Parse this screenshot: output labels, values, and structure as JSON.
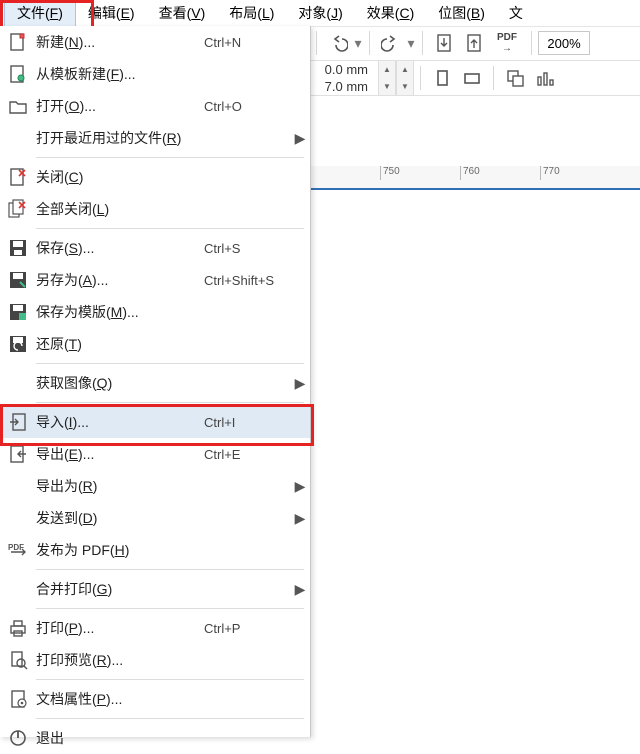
{
  "menubar": [
    {
      "label": "文件",
      "mn": "F",
      "active": true
    },
    {
      "label": "编辑",
      "mn": "E"
    },
    {
      "label": "查看",
      "mn": "V"
    },
    {
      "label": "布局",
      "mn": "L"
    },
    {
      "label": "对象",
      "mn": "J"
    },
    {
      "label": "效果",
      "mn": "C"
    },
    {
      "label": "位图",
      "mn": "B"
    },
    {
      "label": "文",
      "mn": ""
    }
  ],
  "toolbar": {
    "pdf_label": "PDF",
    "zoom": "200%",
    "dim_a": "0.0 mm",
    "dim_b": "7.0 mm"
  },
  "ruler_ticks": [
    "750",
    "760",
    "770"
  ],
  "file_menu": [
    {
      "icon": "new-doc-icon",
      "label": "新建",
      "mn": "N",
      "ellipsis": true,
      "shortcut": "Ctrl+N"
    },
    {
      "icon": "new-from-tpl-icon",
      "label": "从模板新建",
      "mn": "F",
      "ellipsis": true
    },
    {
      "icon": "open-folder-icon",
      "label": "打开",
      "mn": "O",
      "ellipsis": true,
      "shortcut": "Ctrl+O"
    },
    {
      "icon": "",
      "label": "打开最近用过的文件",
      "mn": "R",
      "submenu": true
    },
    {
      "sep": true
    },
    {
      "icon": "close-doc-icon",
      "label": "关闭",
      "mn": "C"
    },
    {
      "icon": "close-all-icon",
      "label": "全部关闭",
      "mn": "L"
    },
    {
      "sep": true
    },
    {
      "icon": "save-icon",
      "label": "保存",
      "mn": "S",
      "ellipsis": true,
      "shortcut": "Ctrl+S"
    },
    {
      "icon": "save-as-icon",
      "label": "另存为",
      "mn": "A",
      "ellipsis": true,
      "shortcut": "Ctrl+Shift+S"
    },
    {
      "icon": "save-tpl-icon",
      "label": "保存为模版",
      "mn": "M",
      "ellipsis": true
    },
    {
      "icon": "revert-icon",
      "label": "还原",
      "mn": "T"
    },
    {
      "sep": true
    },
    {
      "icon": "",
      "label": "获取图像",
      "mn": "Q",
      "submenu": true
    },
    {
      "sep": true
    },
    {
      "icon": "import-icon",
      "label": "导入",
      "mn": "I",
      "ellipsis": true,
      "shortcut": "Ctrl+I",
      "highlight": true
    },
    {
      "icon": "export-icon",
      "label": "导出",
      "mn": "E",
      "ellipsis": true,
      "shortcut": "Ctrl+E"
    },
    {
      "icon": "",
      "label": "导出为",
      "mn": "R",
      "submenu": true
    },
    {
      "icon": "",
      "label": "发送到",
      "mn": "D",
      "submenu": true
    },
    {
      "icon": "pdf-publish-icon",
      "label": "发布为 PDF",
      "mn": "H"
    },
    {
      "sep": true
    },
    {
      "icon": "",
      "label": "合并打印",
      "mn": "G",
      "submenu": true
    },
    {
      "sep": true
    },
    {
      "icon": "print-icon",
      "label": "打印",
      "mn": "P",
      "ellipsis": true,
      "shortcut": "Ctrl+P"
    },
    {
      "icon": "print-preview-icon",
      "label": "打印预览",
      "mn": "R",
      "ellipsis": true
    },
    {
      "sep": true
    },
    {
      "icon": "doc-props-icon",
      "label": "文档属性",
      "mn": "P",
      "ellipsis": true
    },
    {
      "sep": true
    },
    {
      "icon": "exit-icon",
      "label": "退出",
      "mn": "",
      "cut": true
    }
  ]
}
